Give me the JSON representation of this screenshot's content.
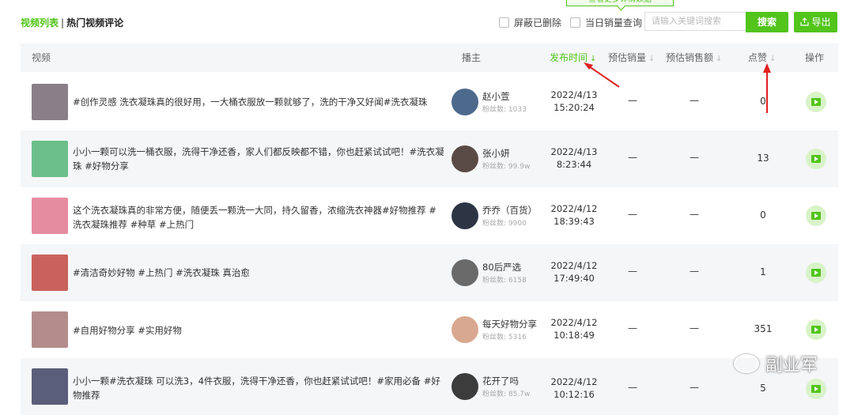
{
  "tabs": {
    "active": "视频列表",
    "separator": "|",
    "other": "热门视频评论"
  },
  "tooltip": "查看更多详情数据",
  "filters": {
    "hide_deleted": "屏蔽已删除",
    "day_sales_query": "当日销量查询"
  },
  "search": {
    "placeholder": "请输入关键词搜索",
    "button": "搜索"
  },
  "export": {
    "label": "导出",
    "icon": "upload-icon"
  },
  "columns": {
    "video": "视频",
    "host": "播主",
    "publish_time": "发布时间",
    "est_sales": "预估销量",
    "est_revenue": "预估销售额",
    "likes": "点赞",
    "action": "操作"
  },
  "sort_icon": "↓",
  "fans_label": "粉丝数:",
  "rows": [
    {
      "title": "#创作灵感 洗衣凝珠真的很好用，一大桶衣服放一颗就够了，洗的干净又好闻#洗衣凝珠",
      "host": "赵小萱",
      "fans": "1033",
      "date": "2022/4/13",
      "time": "15:20:24",
      "sales": "—",
      "revenue": "—",
      "likes": "0",
      "thumb_color": "#8a7f86",
      "avatar_color": "#4d6a8c"
    },
    {
      "title": "小小一颗可以洗一桶衣服，洗得干净还香，家人们都反映都不错，你也赶紧试试吧！#洗衣凝珠 #好物分享",
      "host": "张小妍",
      "fans": "99.9w",
      "date": "2022/4/13",
      "time": "8:23:44",
      "sales": "—",
      "revenue": "—",
      "likes": "13",
      "thumb_color": "#6cbf8a",
      "avatar_color": "#5a4a45"
    },
    {
      "title": "这个洗衣凝珠真的非常方便，随便丢一颗洗一大同，持久留香，浓缩洗衣神器#好物推荐 #洗衣凝珠推荐 #种草 #上热门",
      "host": "乔乔（百货）",
      "fans": "9900",
      "date": "2022/4/12",
      "time": "18:39:43",
      "sales": "—",
      "revenue": "—",
      "likes": "0",
      "thumb_color": "#e58ca0",
      "avatar_color": "#2d3444"
    },
    {
      "title": "#清洁奇妙好物 #上热门 #洗衣凝珠 真治愈",
      "host": "80后严选",
      "fans": "6158",
      "date": "2022/4/12",
      "time": "17:49:40",
      "sales": "—",
      "revenue": "—",
      "likes": "1",
      "thumb_color": "#c9625c",
      "avatar_color": "#6a6a6a"
    },
    {
      "title": "#自用好物分享 #实用好物",
      "host": "每天好物分享",
      "fans": "5316",
      "date": "2022/4/12",
      "time": "10:18:49",
      "sales": "—",
      "revenue": "—",
      "likes": "351",
      "thumb_color": "#b48d8a",
      "avatar_color": "#d9a890"
    },
    {
      "title": "小小一颗#洗衣凝珠 可以洗3，4件衣服，洗得干净还香，你也赶紧试试吧！#家用必备 #好物推荐",
      "host": "花开了吗",
      "fans": "85.7w",
      "date": "2022/4/12",
      "time": "10:12:16",
      "sales": "—",
      "revenue": "—",
      "likes": "5",
      "thumb_color": "#5a5e7a",
      "avatar_color": "#3c3c3c"
    }
  ],
  "watermark": "副业军",
  "colors": {
    "accent": "#52c41a",
    "annotation": "#e02020"
  }
}
